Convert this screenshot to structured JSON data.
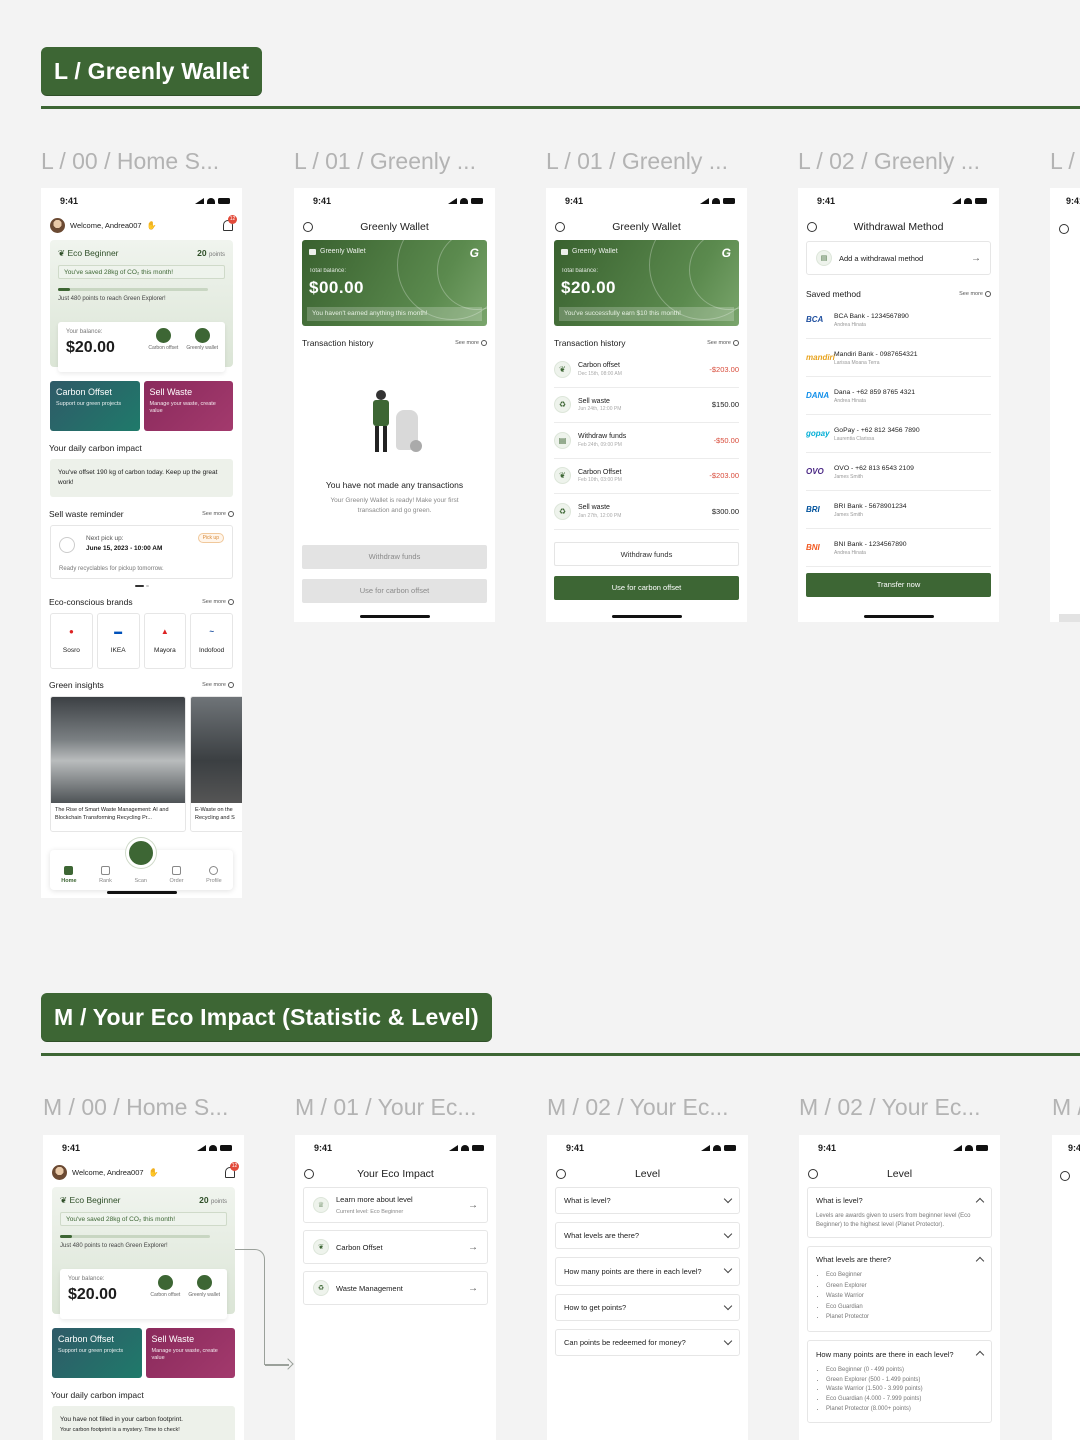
{
  "sections": {
    "l": "L / Greenly Wallet",
    "m": "M / Your Eco Impact (Statistic & Level)"
  },
  "frames": {
    "l0": "L / 00 / Home S...",
    "l1": "L / 01 / Greenly ...",
    "l2": "L / 01 / Greenly ...",
    "l3": "L / 02 / Greenly ...",
    "l4": "L /",
    "m0": "M / 00 / Home S...",
    "m1": "M / 01 / Your Ec...",
    "m2": "M / 02 / Your Ec...",
    "m3": "M / 02 / Your Ec...",
    "m4": "M /"
  },
  "status_time": "9:41",
  "home": {
    "welcome": "Welcome, Andrea007",
    "bell_count": "12",
    "eco_level": "Eco Beginner",
    "points": "20",
    "points_unit": "points",
    "saved": "You've saved 28kg of CO₂ this month!",
    "progress_pct": 8,
    "next_level": "Just 480 points to reach Green Explorer!",
    "balance_label": "Your balance:",
    "balance": "$20.00",
    "act_carbon": "Carbon offset",
    "act_wallet": "Greenly wallet",
    "tile_carbon_title": "Carbon Offset",
    "tile_carbon_sub": "Support our green projects",
    "tile_waste_title": "Sell Waste",
    "tile_waste_sub": "Manage your waste, create value",
    "impact_title": "Your daily carbon impact",
    "impact_text": "You've offset 190 kg of carbon today. Keep up the great work!",
    "impact_text_m": "You have not filled in your carbon footprint.",
    "impact_sub_m": "Your carbon footprint is a mystery. Time to check!",
    "reminder_title": "Sell waste reminder",
    "see_more": "See more",
    "next_pickup": "Next pick up:",
    "pickup_date": "June 15, 2023 - 10:00 AM",
    "pickup_badge": "Pick up",
    "pickup_ready": "Ready recyclables for pickup tomorrow.",
    "brands_title": "Eco-conscious brands",
    "brands": [
      "Sosro",
      "IKEA",
      "Mayora",
      "Indofood"
    ],
    "insights_title": "Green insights",
    "insight1": "The Rise of Smart Waste Management: AI and Blockchain Transforming Recycling Pr...",
    "insight2": "E-Waste on the Recycling and S",
    "tabs": [
      "Home",
      "Rank",
      "Scan",
      "Order",
      "Profile"
    ]
  },
  "wallet": {
    "title": "Greenly Wallet",
    "brand": "Greenly Wallet",
    "total_label": "Total balance:",
    "empty_balance": "$00.00",
    "empty_note": "You haven't earned anything this month!",
    "balance": "$20.00",
    "note": "You've successfully earn $10 this month!",
    "history_title": "Transaction history",
    "see_more": "See more",
    "empty_title": "You have not made any transactions",
    "empty_sub": "Your Greenly Wallet is ready! Make your first transaction and go green.",
    "withdraw": "Withdraw funds",
    "use_carbon": "Use for carbon offset",
    "transactions": [
      {
        "name": "Carbon offset",
        "date": "Dec 15th, 08:00 AM",
        "amount": "-$203.00"
      },
      {
        "name": "Sell waste",
        "date": "Jun 24th, 12:00 PM",
        "amount": "$150.00"
      },
      {
        "name": "Withdraw funds",
        "date": "Feb 24th, 09:00 PM",
        "amount": "-$50.00"
      },
      {
        "name": "Carbon Offset",
        "date": "Feb 10th, 03:00 PM",
        "amount": "-$203.00"
      },
      {
        "name": "Sell waste",
        "date": "Jan 27th, 12:00 PM",
        "amount": "$300.00"
      }
    ]
  },
  "withdrawal": {
    "title": "Withdrawal Method",
    "add": "Add a withdrawal method",
    "saved": "Saved method",
    "see_more": "See more",
    "transfer": "Transfer now",
    "methods": [
      {
        "logo": "BCA",
        "name": "BCA Bank - 1234567890",
        "owner": "Andrea Hinata"
      },
      {
        "logo": "mandiri",
        "name": "Mandiri Bank - 0987654321",
        "owner": "Larissa Moana Terra"
      },
      {
        "logo": "DANA",
        "name": "Dana - +62 859 8765 4321",
        "owner": "Andrea Hinata"
      },
      {
        "logo": "gopay",
        "name": "GoPay - +62 812 3456 7890",
        "owner": "Laurentia Clarissa"
      },
      {
        "logo": "OVO",
        "name": "OVO - +62 813 6543 2109",
        "owner": "James Smith"
      },
      {
        "logo": "BRI",
        "name": "BRI Bank - 5678901234",
        "owner": "James Smith"
      },
      {
        "logo": "BNI",
        "name": "BNI Bank - 1234567890",
        "owner": "Andrea Hinata"
      }
    ]
  },
  "eco_impact": {
    "title": "Your Eco Impact",
    "learn": "Learn more about level",
    "current": "Current level: Eco Beginner",
    "carbon": "Carbon Offset",
    "waste": "Waste Management"
  },
  "level": {
    "title": "Level",
    "q": [
      "What is level?",
      "What levels are there?",
      "How many points are there in each level?",
      "How to get points?",
      "Can points be redeemed for money?"
    ],
    "a1": "Levels are awards given to users from beginner level (Eco Beginner) to the highest level (Planet Protector).",
    "levels": [
      "Eco Beginner",
      "Green Explorer",
      "Waste Warrior",
      "Eco Guardian",
      "Planet Protector"
    ],
    "level_points": [
      "Eco Beginner (0 - 499 points)",
      "Green Explorer (500 - 1.499 points)",
      "Waste Warrior (1.500 - 3.999 points)",
      "Eco Guardian (4.000 - 7.999 points)",
      "Planet Protector (8.000+ points)"
    ]
  }
}
